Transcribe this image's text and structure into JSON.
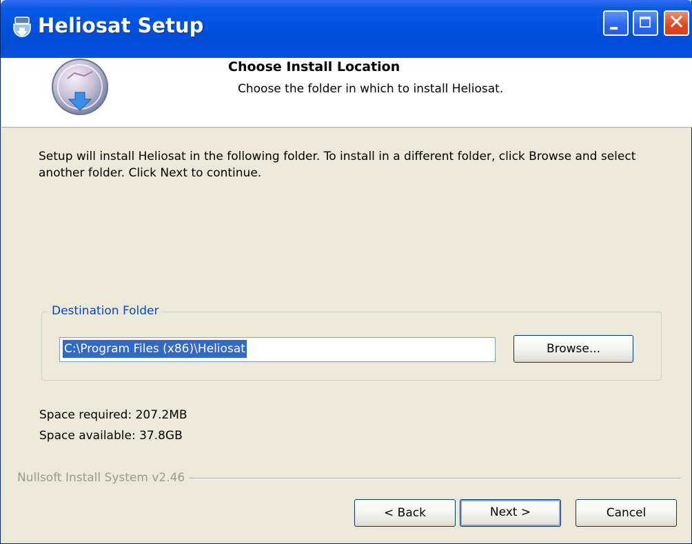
{
  "window": {
    "title": "Heliosat Setup",
    "buttons": {
      "close_glyph": "✕"
    }
  },
  "header": {
    "title": "Choose Install Location",
    "subtitle": "Choose the folder in which to install Heliosat."
  },
  "intro": {
    "text": "Setup will install Heliosat in the following folder. To install in a different folder, click Browse and select another folder. Click Next to continue."
  },
  "destination": {
    "group_label": "Destination Folder",
    "path": "C:\\Program Files (x86)\\Heliosat",
    "browse_label": "Browse..."
  },
  "space": {
    "required": "Space required: 207.2MB",
    "available": "Space available: 37.8GB"
  },
  "branding": "Nullsoft Install System v2.46",
  "nav": {
    "back_label": "< Back",
    "next_label": "Next >",
    "cancel_label": "Cancel"
  },
  "colors": {
    "titlebar": "#0053e1",
    "dialog_bg": "#ece9d8",
    "group_label": "#0046d5",
    "selection": "#316ac5",
    "close_button": "#e0461d"
  }
}
